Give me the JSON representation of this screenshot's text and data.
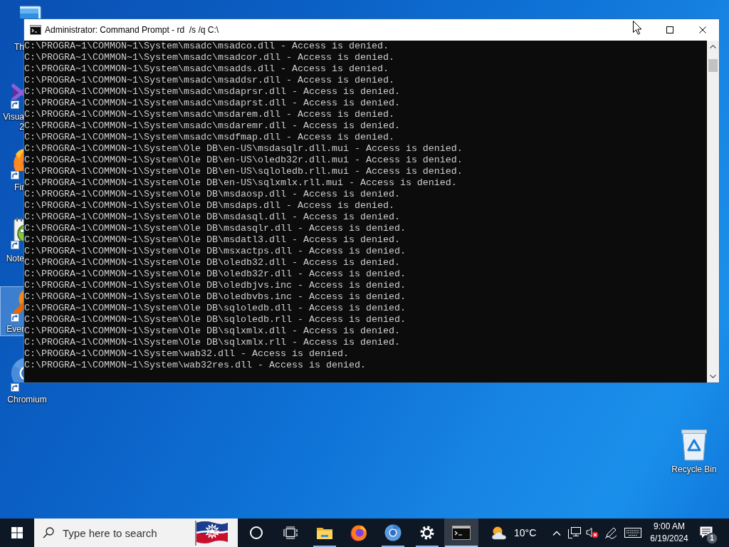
{
  "desktop_icons": [
    {
      "kind": "this-pc",
      "label_lines": [
        "Th"
      ],
      "shortcut": false,
      "selected": false
    },
    {
      "kind": "visual-studio",
      "label_lines": [
        "Visua",
        "2"
      ],
      "shortcut": true,
      "selected": false
    },
    {
      "kind": "firefox",
      "label_lines": [
        "Fir"
      ],
      "shortcut": true,
      "selected": false
    },
    {
      "kind": "notepad-plus-plus",
      "label_lines": [
        "Note"
      ],
      "shortcut": true,
      "selected": false
    },
    {
      "kind": "everything",
      "label_lines": [
        "Ever"
      ],
      "shortcut": true,
      "selected": true
    },
    {
      "kind": "chromium",
      "label_lines": [
        "Chromium"
      ],
      "shortcut": true,
      "selected": false
    },
    {
      "kind": "recycle-bin",
      "label_lines": [
        "Recycle Bin"
      ],
      "shortcut": false,
      "selected": false
    }
  ],
  "window": {
    "title": "Administrator: Command Prompt - rd  /s /q C:\\",
    "console_lines": [
      "C:\\PROGRA~1\\COMMON~1\\System\\msadc\\msadco.dll - Access is denied.",
      "C:\\PROGRA~1\\COMMON~1\\System\\msadc\\msadcor.dll - Access is denied.",
      "C:\\PROGRA~1\\COMMON~1\\System\\msadc\\msadds.dll - Access is denied.",
      "C:\\PROGRA~1\\COMMON~1\\System\\msadc\\msaddsr.dll - Access is denied.",
      "C:\\PROGRA~1\\COMMON~1\\System\\msadc\\msdaprsr.dll - Access is denied.",
      "C:\\PROGRA~1\\COMMON~1\\System\\msadc\\msdaprst.dll - Access is denied.",
      "C:\\PROGRA~1\\COMMON~1\\System\\msadc\\msdarem.dll - Access is denied.",
      "C:\\PROGRA~1\\COMMON~1\\System\\msadc\\msdaremr.dll - Access is denied.",
      "C:\\PROGRA~1\\COMMON~1\\System\\msadc\\msdfmap.dll - Access is denied.",
      "C:\\PROGRA~1\\COMMON~1\\System\\Ole DB\\en-US\\msdasqlr.dll.mui - Access is denied.",
      "C:\\PROGRA~1\\COMMON~1\\System\\Ole DB\\en-US\\oledb32r.dll.mui - Access is denied.",
      "C:\\PROGRA~1\\COMMON~1\\System\\Ole DB\\en-US\\sqloledb.rll.mui - Access is denied.",
      "C:\\PROGRA~1\\COMMON~1\\System\\Ole DB\\en-US\\sqlxmlx.rll.mui - Access is denied.",
      "C:\\PROGRA~1\\COMMON~1\\System\\Ole DB\\msdaosp.dll - Access is denied.",
      "C:\\PROGRA~1\\COMMON~1\\System\\Ole DB\\msdaps.dll - Access is denied.",
      "C:\\PROGRA~1\\COMMON~1\\System\\Ole DB\\msdasql.dll - Access is denied.",
      "C:\\PROGRA~1\\COMMON~1\\System\\Ole DB\\msdasqlr.dll - Access is denied.",
      "C:\\PROGRA~1\\COMMON~1\\System\\Ole DB\\msdatl3.dll - Access is denied.",
      "C:\\PROGRA~1\\COMMON~1\\System\\Ole DB\\msxactps.dll - Access is denied.",
      "C:\\PROGRA~1\\COMMON~1\\System\\Ole DB\\oledb32.dll - Access is denied.",
      "C:\\PROGRA~1\\COMMON~1\\System\\Ole DB\\oledb32r.dll - Access is denied.",
      "C:\\PROGRA~1\\COMMON~1\\System\\Ole DB\\oledbjvs.inc - Access is denied.",
      "C:\\PROGRA~1\\COMMON~1\\System\\Ole DB\\oledbvbs.inc - Access is denied.",
      "C:\\PROGRA~1\\COMMON~1\\System\\Ole DB\\sqloledb.dll - Access is denied.",
      "C:\\PROGRA~1\\COMMON~1\\System\\Ole DB\\sqloledb.rll - Access is denied.",
      "C:\\PROGRA~1\\COMMON~1\\System\\Ole DB\\sqlxmlx.dll - Access is denied.",
      "C:\\PROGRA~1\\COMMON~1\\System\\Ole DB\\sqlxmlx.rll - Access is denied.",
      "C:\\PROGRA~1\\COMMON~1\\System\\wab32.dll - Access is denied.",
      "C:\\PROGRA~1\\COMMON~1\\System\\wab32res.dll - Access is denied."
    ]
  },
  "taskbar": {
    "search": {
      "placeholder": "Type here to search"
    },
    "apps": [
      {
        "kind": "cortana",
        "running": false,
        "active": false
      },
      {
        "kind": "task-view",
        "running": false,
        "active": false
      },
      {
        "kind": "file-explorer",
        "running": true,
        "active": false
      },
      {
        "kind": "firefox",
        "running": false,
        "active": false
      },
      {
        "kind": "chromium",
        "running": true,
        "active": false
      },
      {
        "kind": "settings",
        "running": true,
        "active": false
      },
      {
        "kind": "command-prompt",
        "running": true,
        "active": true
      }
    ],
    "weather": {
      "temperature": "10°C"
    },
    "tray": {
      "volume_muted": true
    },
    "clock": {
      "time": "9:00 AM",
      "date": "6/19/2024"
    },
    "notifications": {
      "count": "1"
    }
  }
}
